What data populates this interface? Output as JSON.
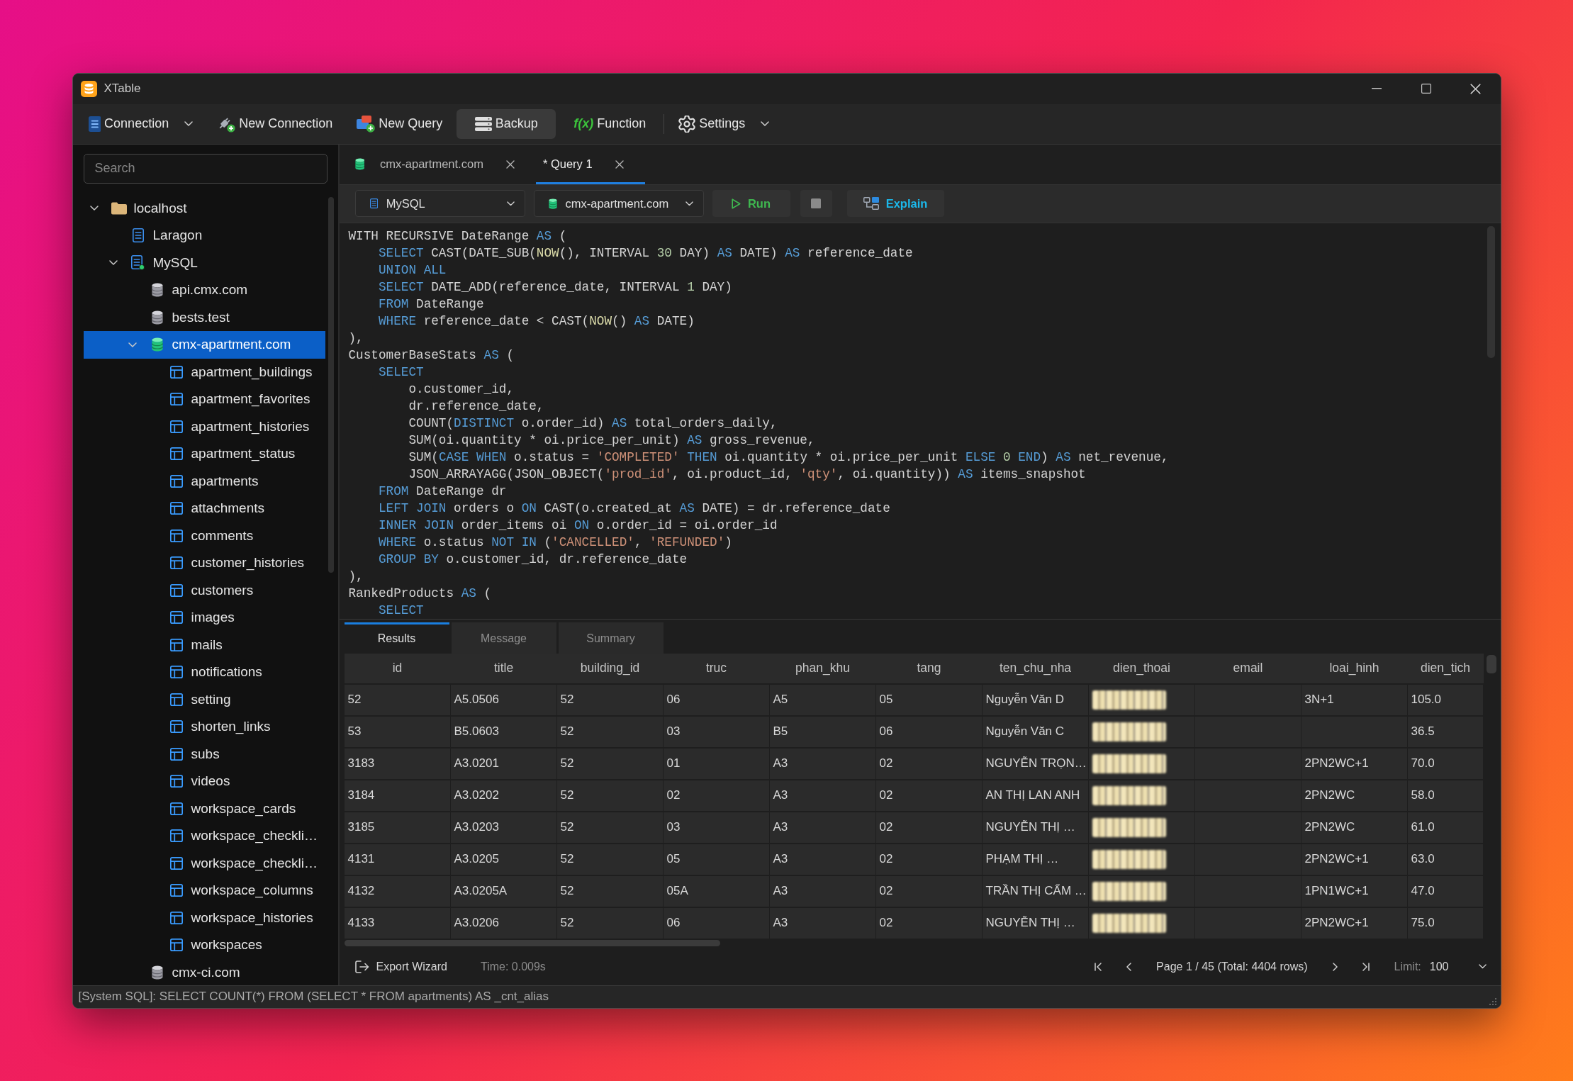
{
  "window": {
    "title": "XTable"
  },
  "toolbar": [
    {
      "label": "Connection",
      "menu": true,
      "highlighted": false
    },
    {
      "label": "New Connection",
      "menu": false,
      "highlighted": false
    },
    {
      "label": "New Query",
      "menu": false,
      "highlighted": false
    },
    {
      "label": "Backup",
      "menu": false,
      "highlighted": true
    },
    {
      "label": "Function",
      "glyph": "f(x)",
      "menu": false,
      "highlighted": false
    },
    {
      "label": "Settings",
      "menu": true,
      "highlighted": false
    }
  ],
  "sidebar": {
    "search": {
      "placeholder": "Search"
    },
    "tree": [
      {
        "label": "localhost",
        "kind": "folder",
        "expanded": true,
        "selected": false,
        "children": [
          {
            "label": "Laragon",
            "kind": "server",
            "connected": false,
            "expanded": false,
            "selected": false
          },
          {
            "label": "MySQL",
            "kind": "server",
            "connected": true,
            "expanded": true,
            "selected": false,
            "children": [
              {
                "label": "api.cmx.com",
                "kind": "database",
                "opened": false,
                "expanded": false,
                "selected": false
              },
              {
                "label": "bests.test",
                "kind": "database",
                "opened": false,
                "expanded": false,
                "selected": false
              },
              {
                "label": "cmx-apartment.com",
                "kind": "database",
                "opened": true,
                "expanded": true,
                "selected": true,
                "children": [
                  {
                    "label": "apartment_buildings",
                    "kind": "table",
                    "expanded": false,
                    "selected": false
                  },
                  {
                    "label": "apartment_favorites",
                    "kind": "table",
                    "expanded": false,
                    "selected": false
                  },
                  {
                    "label": "apartment_histories",
                    "kind": "table",
                    "expanded": false,
                    "selected": false
                  },
                  {
                    "label": "apartment_status",
                    "kind": "table",
                    "expanded": false,
                    "selected": false
                  },
                  {
                    "label": "apartments",
                    "kind": "table",
                    "expanded": false,
                    "selected": false
                  },
                  {
                    "label": "attachments",
                    "kind": "table",
                    "expanded": false,
                    "selected": false
                  },
                  {
                    "label": "comments",
                    "kind": "table",
                    "expanded": false,
                    "selected": false
                  },
                  {
                    "label": "customer_histories",
                    "kind": "table",
                    "expanded": false,
                    "selected": false
                  },
                  {
                    "label": "customers",
                    "kind": "table",
                    "expanded": false,
                    "selected": false
                  },
                  {
                    "label": "images",
                    "kind": "table",
                    "expanded": false,
                    "selected": false
                  },
                  {
                    "label": "mails",
                    "kind": "table",
                    "expanded": false,
                    "selected": false
                  },
                  {
                    "label": "notifications",
                    "kind": "table",
                    "expanded": false,
                    "selected": false
                  },
                  {
                    "label": "setting",
                    "kind": "table",
                    "expanded": false,
                    "selected": false
                  },
                  {
                    "label": "shorten_links",
                    "kind": "table",
                    "expanded": false,
                    "selected": false
                  },
                  {
                    "label": "subs",
                    "kind": "table",
                    "expanded": false,
                    "selected": false
                  },
                  {
                    "label": "videos",
                    "kind": "table",
                    "expanded": false,
                    "selected": false
                  },
                  {
                    "label": "workspace_cards",
                    "kind": "table",
                    "expanded": false,
                    "selected": false
                  },
                  {
                    "label": "workspace_checkli…",
                    "kind": "table",
                    "expanded": false,
                    "selected": false
                  },
                  {
                    "label": "workspace_checkli…",
                    "kind": "table",
                    "expanded": false,
                    "selected": false
                  },
                  {
                    "label": "workspace_columns",
                    "kind": "table",
                    "expanded": false,
                    "selected": false
                  },
                  {
                    "label": "workspace_histories",
                    "kind": "table",
                    "expanded": false,
                    "selected": false
                  },
                  {
                    "label": "workspaces",
                    "kind": "table",
                    "expanded": false,
                    "selected": false
                  }
                ]
              },
              {
                "label": "cmx-ci.com",
                "kind": "database",
                "opened": false,
                "expanded": false,
                "selected": false
              }
            ]
          }
        ]
      }
    ]
  },
  "tabs": [
    {
      "label": "cmx-apartment.com",
      "kind": "database",
      "selected": false
    },
    {
      "label": "* Query 1",
      "kind": "query",
      "selected": true
    }
  ],
  "editor_toolbar": {
    "engine": "MySQL",
    "database": "cmx-apartment.com",
    "run": "Run",
    "explain": "Explain"
  },
  "editor": {
    "lines": [
      {
        "tokens": [
          "WITH RECURSIVE DateRange ",
          {
            "kind": "keyword",
            "text": "AS"
          },
          " ("
        ],
        "children": [
          {
            "tokens": [
              {
                "kind": "keyword",
                "text": "SELECT"
              },
              " CAST(DATE_SUB(",
              {
                "kind": "function",
                "text": "NOW"
              },
              "(), INTERVAL ",
              {
                "kind": "number",
                "text": "30"
              },
              " DAY) ",
              {
                "kind": "keyword",
                "text": "AS"
              },
              " DATE) ",
              {
                "kind": "keyword",
                "text": "AS"
              },
              " reference_date"
            ]
          },
          {
            "tokens": [
              {
                "kind": "keyword",
                "text": "UNION ALL"
              }
            ]
          },
          {
            "tokens": [
              {
                "kind": "keyword",
                "text": "SELECT"
              },
              " DATE_ADD(reference_date, INTERVAL ",
              {
                "kind": "number",
                "text": "1"
              },
              " DAY)"
            ]
          },
          {
            "tokens": [
              {
                "kind": "keyword",
                "text": "FROM"
              },
              " DateRange"
            ]
          },
          {
            "tokens": [
              {
                "kind": "keyword",
                "text": "WHERE"
              },
              " reference_date < CAST(",
              {
                "kind": "function",
                "text": "NOW"
              },
              "() ",
              {
                "kind": "keyword",
                "text": "AS"
              },
              " DATE)"
            ]
          }
        ]
      },
      {
        "tokens": [
          "),"
        ]
      },
      {
        "tokens": [
          "CustomerBaseStats ",
          {
            "kind": "keyword",
            "text": "AS"
          },
          " ("
        ],
        "children": [
          {
            "tokens": [
              {
                "kind": "keyword",
                "text": "SELECT"
              }
            ],
            "children": [
              {
                "tokens": [
                  "o.customer_id,"
                ]
              },
              {
                "tokens": [
                  "dr.reference_date,"
                ]
              },
              {
                "tokens": [
                  "COUNT(",
                  {
                    "kind": "keyword",
                    "text": "DISTINCT"
                  },
                  " o.order_id) ",
                  {
                    "kind": "keyword",
                    "text": "AS"
                  },
                  " total_orders_daily,"
                ]
              },
              {
                "tokens": [
                  "SUM(oi.quantity * oi.price_per_unit) ",
                  {
                    "kind": "keyword",
                    "text": "AS"
                  },
                  " gross_revenue,"
                ]
              },
              {
                "tokens": [
                  "SUM(",
                  {
                    "kind": "keyword",
                    "text": "CASE WHEN"
                  },
                  " o.status = ",
                  {
                    "kind": "string",
                    "text": "'COMPLETED'"
                  },
                  {
                    "kind": "keyword",
                    "text": " THEN"
                  },
                  " oi.quantity * oi.price_per_unit ",
                  {
                    "kind": "keyword",
                    "text": "ELSE"
                  },
                  {
                    "kind": "number",
                    "text": " 0"
                  },
                  {
                    "kind": "keyword",
                    "text": " END"
                  },
                  ") ",
                  {
                    "kind": "keyword",
                    "text": "AS"
                  },
                  " net_revenue,"
                ]
              },
              {
                "tokens": [
                  "JSON_ARRAYAGG(JSON_OBJECT(",
                  {
                    "kind": "string",
                    "text": "'prod_id'"
                  },
                  ", oi.product_id, ",
                  {
                    "kind": "string",
                    "text": "'qty'"
                  },
                  ", oi.quantity)) ",
                  {
                    "kind": "keyword",
                    "text": "AS"
                  },
                  " items_snapshot"
                ]
              }
            ]
          },
          {
            "tokens": [
              {
                "kind": "keyword",
                "text": "FROM"
              },
              " DateRange dr"
            ]
          },
          {
            "tokens": [
              {
                "kind": "keyword",
                "text": "LEFT JOIN"
              },
              " orders o ",
              {
                "kind": "keyword",
                "text": "ON"
              },
              " CAST(o.created_at ",
              {
                "kind": "keyword",
                "text": "AS"
              },
              " DATE) = dr.reference_date"
            ]
          },
          {
            "tokens": [
              {
                "kind": "keyword",
                "text": "INNER JOIN"
              },
              " order_items oi ",
              {
                "kind": "keyword",
                "text": "ON"
              },
              " o.order_id = oi.order_id"
            ]
          },
          {
            "tokens": [
              {
                "kind": "keyword",
                "text": "WHERE"
              },
              " o.status ",
              {
                "kind": "keyword",
                "text": "NOT IN"
              },
              " (",
              {
                "kind": "string",
                "text": "'CANCELLED'"
              },
              ", ",
              {
                "kind": "string",
                "text": "'REFUNDED'"
              },
              ")"
            ]
          },
          {
            "tokens": [
              {
                "kind": "keyword",
                "text": "GROUP BY"
              },
              " o.customer_id, dr.reference_date"
            ]
          }
        ]
      },
      {
        "tokens": [
          "),"
        ]
      },
      {
        "tokens": [
          "RankedProducts ",
          {
            "kind": "keyword",
            "text": "AS"
          },
          " ("
        ],
        "children": [
          {
            "tokens": [
              {
                "kind": "keyword",
                "text": "SELECT"
              }
            ]
          }
        ]
      }
    ]
  },
  "result_tabs": [
    {
      "label": "Results",
      "selected": true
    },
    {
      "label": "Message",
      "selected": false
    },
    {
      "label": "Summary",
      "selected": false
    }
  ],
  "table": {
    "columns": [
      "id",
      "title",
      "building_id",
      "truc",
      "phan_khu",
      "tang",
      "ten_chu_nha",
      "dien_thoai",
      "email",
      "loai_hinh",
      "dien_tich"
    ],
    "rows": [
      [
        "52",
        "A5.0506",
        "52",
        "06",
        "A5",
        "05",
        "Nguyễn Văn D",
        {
          "kind": "blurred"
        },
        {
          "kind": "empty"
        },
        "3N+1",
        "105.0"
      ],
      [
        "53",
        "B5.0603",
        "52",
        "03",
        "B5",
        "06",
        "Nguyễn Văn C",
        {
          "kind": "blurred"
        },
        {
          "kind": "empty"
        },
        {
          "kind": "empty"
        },
        "36.5"
      ],
      [
        "3183",
        "A3.0201",
        "52",
        "01",
        "A3",
        "02",
        "NGUYỄN TRỌN…",
        {
          "kind": "blurred"
        },
        {
          "kind": "empty"
        },
        "2PN2WC+1",
        "70.0"
      ],
      [
        "3184",
        "A3.0202",
        "52",
        "02",
        "A3",
        "02",
        "AN THỊ LAN ANH",
        {
          "kind": "blurred"
        },
        {
          "kind": "empty"
        },
        "2PN2WC",
        "58.0"
      ],
      [
        "3185",
        "A3.0203",
        "52",
        "03",
        "A3",
        "02",
        "NGUYỄN THỊ …",
        {
          "kind": "blurred"
        },
        {
          "kind": "empty"
        },
        "2PN2WC",
        "61.0"
      ],
      [
        "4131",
        "A3.0205",
        "52",
        "05",
        "A3",
        "02",
        "PHẠM THỊ …",
        {
          "kind": "blurred"
        },
        {
          "kind": "empty"
        },
        "2PN2WC+1",
        "63.0"
      ],
      [
        "4132",
        "A3.0205A",
        "52",
        "05A",
        "A3",
        "02",
        "TRẦN THỊ CẨM …",
        {
          "kind": "blurred"
        },
        {
          "kind": "empty"
        },
        "1PN1WC+1",
        "47.0"
      ],
      [
        "4133",
        "A3.0206",
        "52",
        "06",
        "A3",
        "02",
        "NGUYỄN THỊ …",
        {
          "kind": "blurred"
        },
        {
          "kind": "empty"
        },
        "2PN2WC+1",
        "75.0"
      ]
    ]
  },
  "footer": {
    "export": "Export Wizard",
    "time": "Time: 0.009s",
    "pagination": "Page 1 / 45 (Total: 4404 rows)",
    "limit_label": "Limit:",
    "limit": "100"
  },
  "status_bar": {
    "text": "[System SQL]: SELECT COUNT(*) FROM (SELECT * FROM apartments) AS _cnt_alias"
  }
}
